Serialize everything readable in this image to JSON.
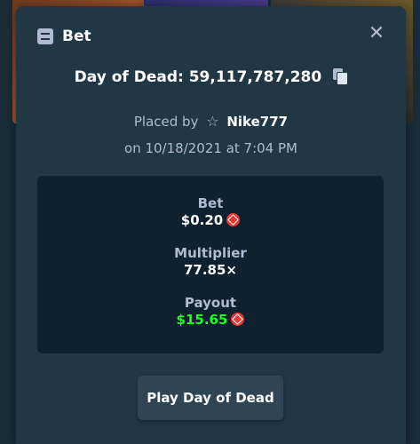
{
  "modal": {
    "title": "Bet",
    "close_icon": "close-icon",
    "header_icon": "bet-list-icon"
  },
  "bet": {
    "id_text": "Day of Dead: 59,117,787,280",
    "placed_by_prefix": "Placed by",
    "user": "Nike777",
    "date_text": "on 10/18/2021 at 7:04 PM"
  },
  "stats": {
    "bet_label": "Bet",
    "bet_value": "$0.20",
    "multiplier_label": "Multiplier",
    "multiplier_value": "77.85×",
    "payout_label": "Payout",
    "payout_value": "$15.65",
    "currency_icon": "tron-icon"
  },
  "actions": {
    "play_label": "Play Day of Dead"
  },
  "colors": {
    "background": "#1a2c38",
    "modal": "#213743",
    "panel": "#0f212e",
    "payout_green": "#1fff20",
    "currency_red": "#e53935",
    "button": "#2f4553"
  }
}
